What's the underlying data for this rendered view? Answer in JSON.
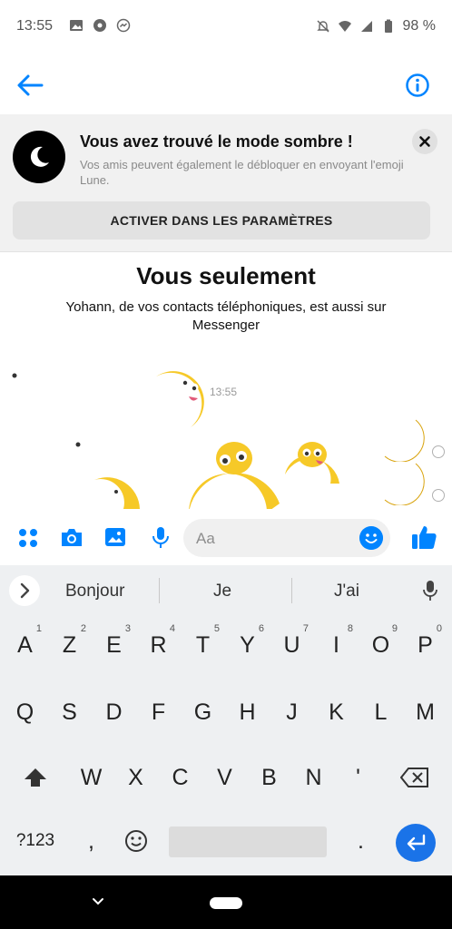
{
  "status_bar": {
    "time": "13:55",
    "battery": "98 %",
    "icons_left": [
      "image-icon",
      "soccer-icon",
      "messenger-icon"
    ],
    "icons_right": [
      "bell-off-icon",
      "wifi-icon",
      "signal-icon",
      "battery-icon"
    ]
  },
  "header": {
    "back_icon": "arrow-left-icon",
    "info_icon": "info-icon",
    "accent": "#0084ff"
  },
  "banner": {
    "title": "Vous avez trouvé le mode sombre !",
    "subtitle": "Vos amis peuvent également le débloquer en envoyant l'emoji Lune.",
    "button": "ACTIVER DANS LES PARAMÈTRES",
    "close_icon": "close-icon"
  },
  "chat": {
    "title": "Vous seulement",
    "subtitle": "Yohann, de vos contacts téléphoniques, est aussi sur Messenger",
    "timestamp": "13:55",
    "messages": [
      "🌙",
      "🌙"
    ]
  },
  "composer": {
    "placeholder": "Aa",
    "icons": [
      "apps-icon",
      "camera-icon",
      "image-icon",
      "mic-icon",
      "emoji-icon",
      "thumbs-up-icon"
    ]
  },
  "keyboard": {
    "suggestions": [
      "Bonjour",
      "Je",
      "J'ai"
    ],
    "row1": [
      "A",
      "Z",
      "E",
      "R",
      "T",
      "Y",
      "U",
      "I",
      "O",
      "P"
    ],
    "row1_nums": [
      "1",
      "2",
      "3",
      "4",
      "5",
      "6",
      "7",
      "8",
      "9",
      "0"
    ],
    "row2": [
      "Q",
      "S",
      "D",
      "F",
      "G",
      "H",
      "J",
      "K",
      "L",
      "M"
    ],
    "row3": [
      "W",
      "X",
      "C",
      "V",
      "B",
      "N",
      "'"
    ],
    "row4": {
      "symbols": "?123",
      "comma": ",",
      "period": "."
    }
  }
}
